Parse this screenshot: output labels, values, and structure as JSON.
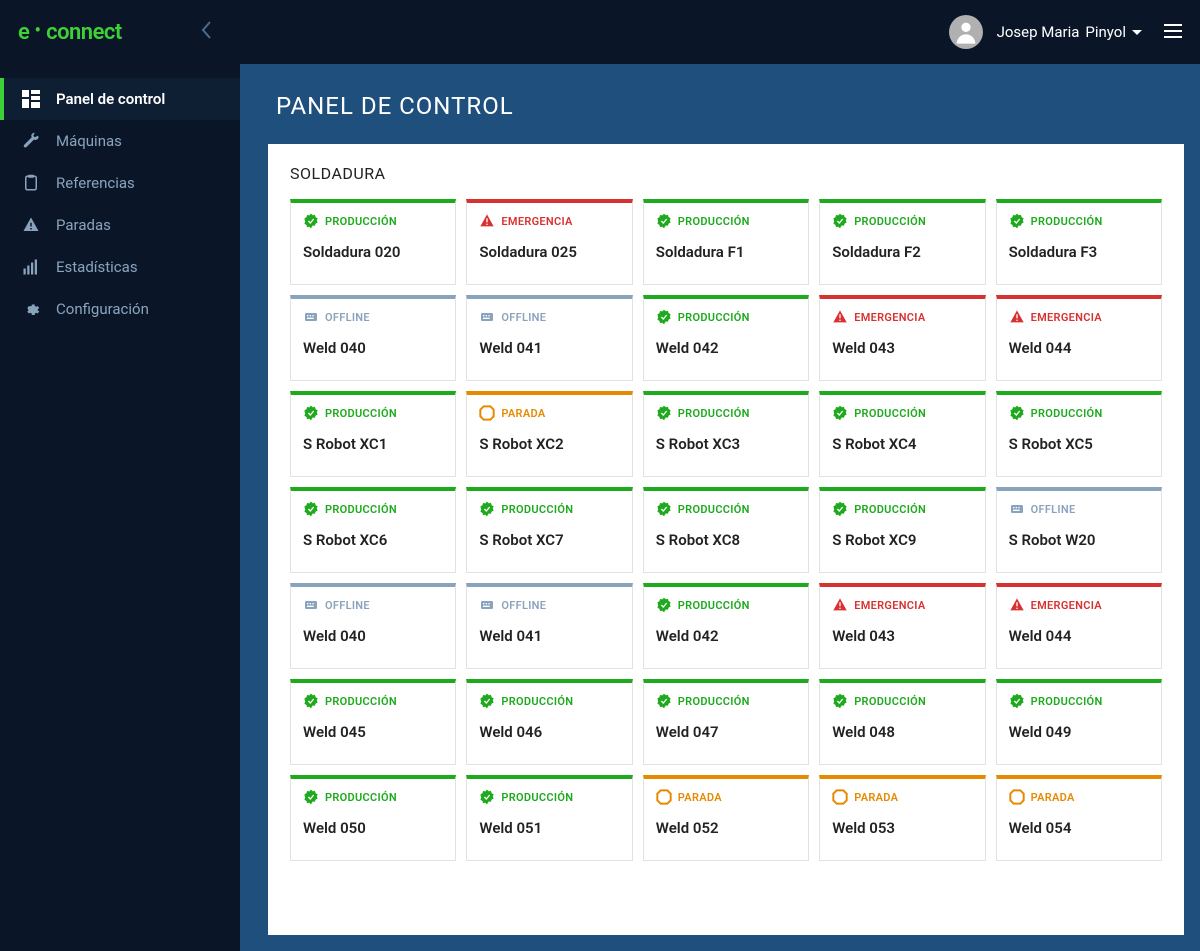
{
  "brand": {
    "left": "e",
    "right": "connect"
  },
  "user": {
    "first": "Josep Maria",
    "last": "Pinyol"
  },
  "sidebar": {
    "items": [
      {
        "label": "Panel de control",
        "icon": "dashboard",
        "active": true
      },
      {
        "label": "Máquinas",
        "icon": "wrench",
        "active": false
      },
      {
        "label": "Referencias",
        "icon": "clipboard",
        "active": false
      },
      {
        "label": "Paradas",
        "icon": "warning",
        "active": false
      },
      {
        "label": "Estadísticas",
        "icon": "stats",
        "active": false
      },
      {
        "label": "Configuración",
        "icon": "gear",
        "active": false
      }
    ]
  },
  "page": {
    "title": "PANEL DE CONTROL",
    "section": "SOLDADURA"
  },
  "status_labels": {
    "produccion": "PRODUCCIÓN",
    "emergencia": "EMERGENCIA",
    "parada": "PARADA",
    "offline": "OFFLINE"
  },
  "colors": {
    "produccion": "#1daa1d",
    "emergencia": "#d93030",
    "parada": "#e68a00",
    "offline": "#8aa3bd",
    "accent": "#3dd137"
  },
  "machines": [
    {
      "name": "Soldadura 020",
      "status": "produccion"
    },
    {
      "name": "Soldadura 025",
      "status": "emergencia"
    },
    {
      "name": "Soldadura F1",
      "status": "produccion"
    },
    {
      "name": "Soldadura F2",
      "status": "produccion"
    },
    {
      "name": "Soldadura F3",
      "status": "produccion"
    },
    {
      "name": "Weld 040",
      "status": "offline"
    },
    {
      "name": "Weld 041",
      "status": "offline"
    },
    {
      "name": "Weld 042",
      "status": "produccion"
    },
    {
      "name": "Weld 043",
      "status": "emergencia"
    },
    {
      "name": "Weld 044",
      "status": "emergencia"
    },
    {
      "name": "S Robot XC1",
      "status": "produccion"
    },
    {
      "name": "S Robot XC2",
      "status": "parada"
    },
    {
      "name": "S Robot XC3",
      "status": "produccion"
    },
    {
      "name": "S Robot XC4",
      "status": "produccion"
    },
    {
      "name": "S Robot XC5",
      "status": "produccion"
    },
    {
      "name": "S Robot XC6",
      "status": "produccion"
    },
    {
      "name": "S Robot XC7",
      "status": "produccion"
    },
    {
      "name": "S Robot XC8",
      "status": "produccion"
    },
    {
      "name": "S Robot XC9",
      "status": "produccion"
    },
    {
      "name": "S Robot W20",
      "status": "offline"
    },
    {
      "name": "Weld 040",
      "status": "offline"
    },
    {
      "name": "Weld 041",
      "status": "offline"
    },
    {
      "name": "Weld 042",
      "status": "produccion"
    },
    {
      "name": "Weld 043",
      "status": "emergencia"
    },
    {
      "name": "Weld 044",
      "status": "emergencia"
    },
    {
      "name": "Weld 045",
      "status": "produccion"
    },
    {
      "name": "Weld 046",
      "status": "produccion"
    },
    {
      "name": "Weld 047",
      "status": "produccion"
    },
    {
      "name": "Weld 048",
      "status": "produccion"
    },
    {
      "name": "Weld 049",
      "status": "produccion"
    },
    {
      "name": "Weld 050",
      "status": "produccion"
    },
    {
      "name": "Weld 051",
      "status": "produccion"
    },
    {
      "name": "Weld 052",
      "status": "parada"
    },
    {
      "name": "Weld 053",
      "status": "parada"
    },
    {
      "name": "Weld 054",
      "status": "parada"
    }
  ]
}
